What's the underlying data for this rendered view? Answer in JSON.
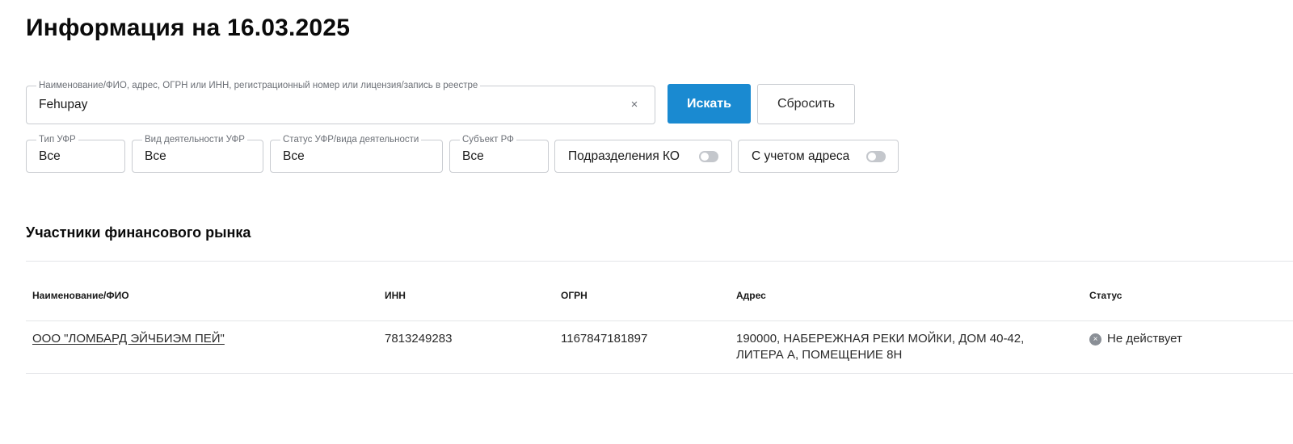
{
  "header": {
    "title": "Информация на 16.03.2025"
  },
  "search": {
    "label": "Наименование/ФИО, адрес, ОГРН или ИНН, регистрационный номер или лицензия/запись в реестре",
    "value": "Fehupay",
    "clear_icon": "×",
    "search_button": "Искать",
    "reset_button": "Сбросить"
  },
  "filters": {
    "type": {
      "label": "Тип УФР",
      "value": "Все"
    },
    "activity": {
      "label": "Вид деятельности УФР",
      "value": "Все"
    },
    "status": {
      "label": "Статус УФР/вида деятельности",
      "value": "Все"
    },
    "subject": {
      "label": "Субъект РФ",
      "value": "Все"
    },
    "ko_toggle": {
      "label": "Подразделения КО",
      "on": false
    },
    "address_toggle": {
      "label": "С учетом адреса",
      "on": false
    }
  },
  "section": {
    "title": "Участники финансового рынка"
  },
  "table": {
    "columns": [
      "Наименование/ФИО",
      "ИНН",
      "ОГРН",
      "Адрес",
      "Статус"
    ],
    "rows": [
      {
        "name": "ООО \"ЛОМБАРД ЭЙЧБИЭМ ПЕЙ\"",
        "inn": "7813249283",
        "ogrn": "1167847181897",
        "address": "190000, НАБЕРЕЖНАЯ РЕКИ МОЙКИ, ДОМ 40-42, ЛИТЕРА А, ПОМЕЩЕНИЕ 8Н",
        "status": "Не действует",
        "status_icon": "×"
      }
    ]
  },
  "colors": {
    "accent": "#1a8ad1",
    "border": "#c9ccd1",
    "status_inactive": "#8a8f96"
  }
}
